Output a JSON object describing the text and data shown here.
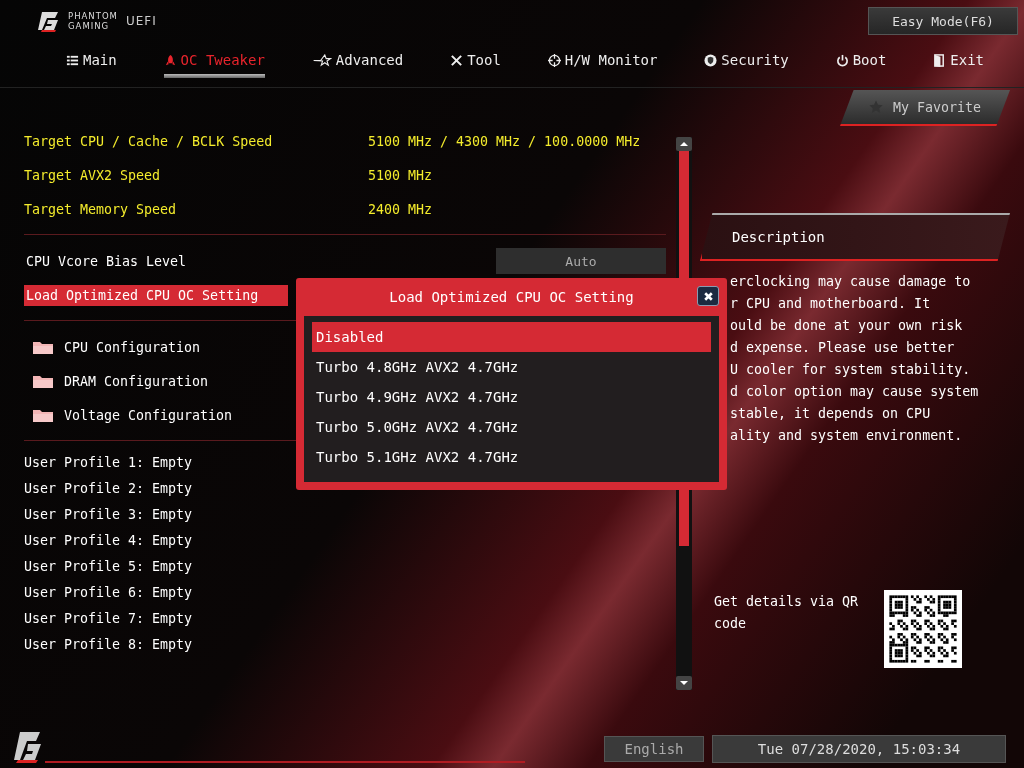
{
  "header": {
    "brand_line1": "PHANTOM",
    "brand_line2": "GAMING",
    "product": "UEFI",
    "mode_button": "Easy Mode(F6)"
  },
  "tabs": [
    {
      "label": "Main",
      "selected": false
    },
    {
      "label": "OC Tweaker",
      "selected": true
    },
    {
      "label": "Advanced",
      "selected": false
    },
    {
      "label": "Tool",
      "selected": false
    },
    {
      "label": "H/W Monitor",
      "selected": false
    },
    {
      "label": "Security",
      "selected": false
    },
    {
      "label": "Boot",
      "selected": false
    },
    {
      "label": "Exit",
      "selected": false
    }
  ],
  "favorite_button": "My Favorite",
  "info_rows": [
    {
      "label": "Target CPU / Cache / BCLK Speed",
      "value": "5100 MHz / 4300 MHz / 100.0000 MHz"
    },
    {
      "label": "Target AVX2 Speed",
      "value": "5100 MHz"
    },
    {
      "label": "Target Memory Speed",
      "value": "2400 MHz"
    }
  ],
  "settings": [
    {
      "label": "CPU Vcore Bias Level",
      "value": "Auto",
      "selected": false
    },
    {
      "label": "Load Optimized CPU OC Setting",
      "selected": true
    }
  ],
  "submenus": [
    "CPU Configuration",
    "DRAM Configuration",
    "Voltage Configuration"
  ],
  "profiles": [
    "User Profile 1: Empty",
    "User Profile 2: Empty",
    "User Profile 3: Empty",
    "User Profile 4: Empty",
    "User Profile 5: Empty",
    "User Profile 6: Empty",
    "User Profile 7: Empty",
    "User Profile 8: Empty"
  ],
  "description": {
    "title": "Description",
    "lines": [
      "erclocking may cause damage to",
      "r CPU and motherboard. It",
      "ould be done at your own risk",
      "d expense. Please use better",
      "U cooler for system stability.",
      "d color option may cause system",
      "stable, it depends on CPU",
      "ality and system environment."
    ]
  },
  "qr": {
    "text": "Get details via QR code"
  },
  "dialog": {
    "title": "Load Optimized CPU OC Setting",
    "options": [
      {
        "label": "Disabled",
        "selected": true
      },
      {
        "label": "Turbo 4.8GHz AVX2 4.7GHz",
        "selected": false
      },
      {
        "label": "Turbo 4.9GHz AVX2 4.7GHz",
        "selected": false
      },
      {
        "label": "Turbo 5.0GHz AVX2 4.7GHz",
        "selected": false
      },
      {
        "label": "Turbo 5.1GHz AVX2 4.7GHz",
        "selected": false
      }
    ]
  },
  "footer": {
    "language": "English",
    "datetime": "Tue 07/28/2020, 15:03:34"
  }
}
